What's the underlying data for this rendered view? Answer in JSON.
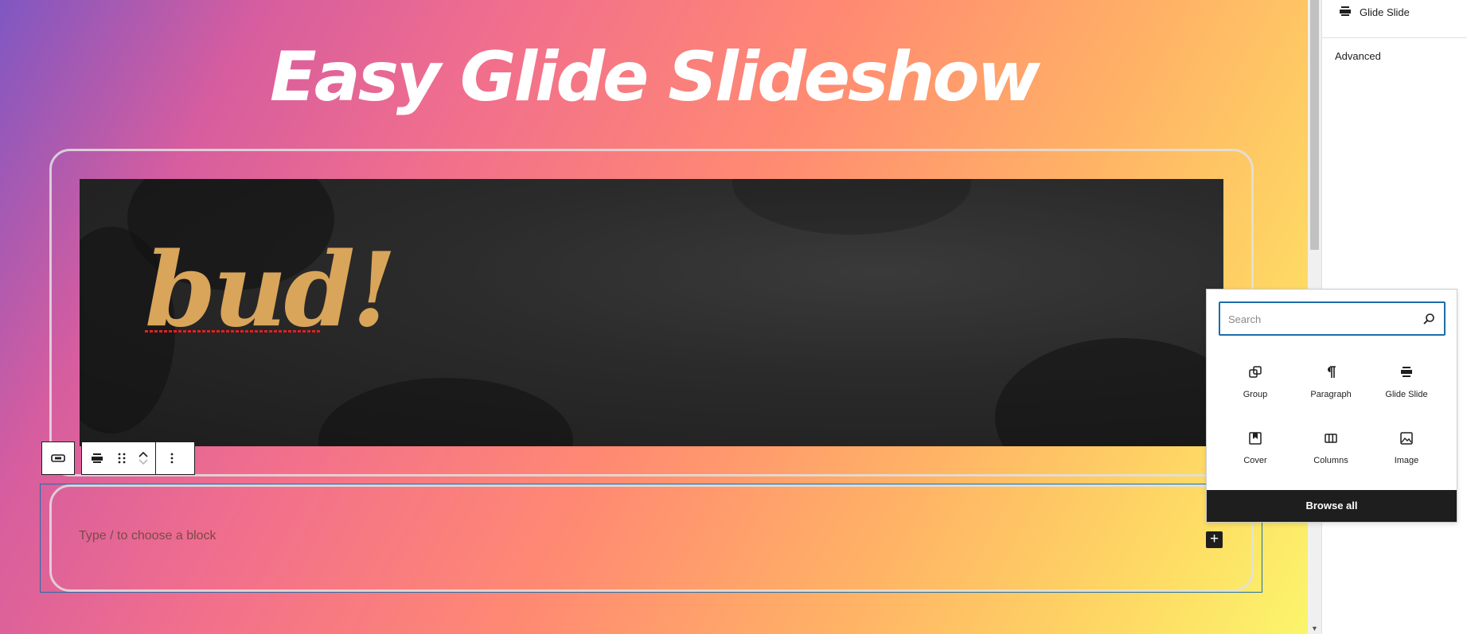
{
  "canvas": {
    "page_title": "Easy Glide Slideshow",
    "slide": {
      "text": "bud!"
    },
    "empty_block": {
      "placeholder": "Type / to choose a block"
    }
  },
  "sidebar": {
    "block_name": "Glide Slide",
    "advanced_label": "Advanced"
  },
  "inserter": {
    "search_placeholder": "Search",
    "items": [
      {
        "label": "Group",
        "icon": "group-icon"
      },
      {
        "label": "Paragraph",
        "icon": "paragraph-icon"
      },
      {
        "label": "Glide Slide",
        "icon": "glide-slide-icon"
      },
      {
        "label": "Cover",
        "icon": "cover-icon"
      },
      {
        "label": "Columns",
        "icon": "columns-icon"
      },
      {
        "label": "Image",
        "icon": "image-icon"
      }
    ],
    "browse_all": "Browse all"
  },
  "toolbar": {
    "icons": [
      "select-parent-icon",
      "glide-slide-icon",
      "drag-handle-icon",
      "move-up-icon",
      "move-down-icon",
      "more-options-icon"
    ]
  },
  "colors": {
    "slide_text": "#d9a55a",
    "accent": "#1e6ca8",
    "dark": "#1e1e1e"
  }
}
